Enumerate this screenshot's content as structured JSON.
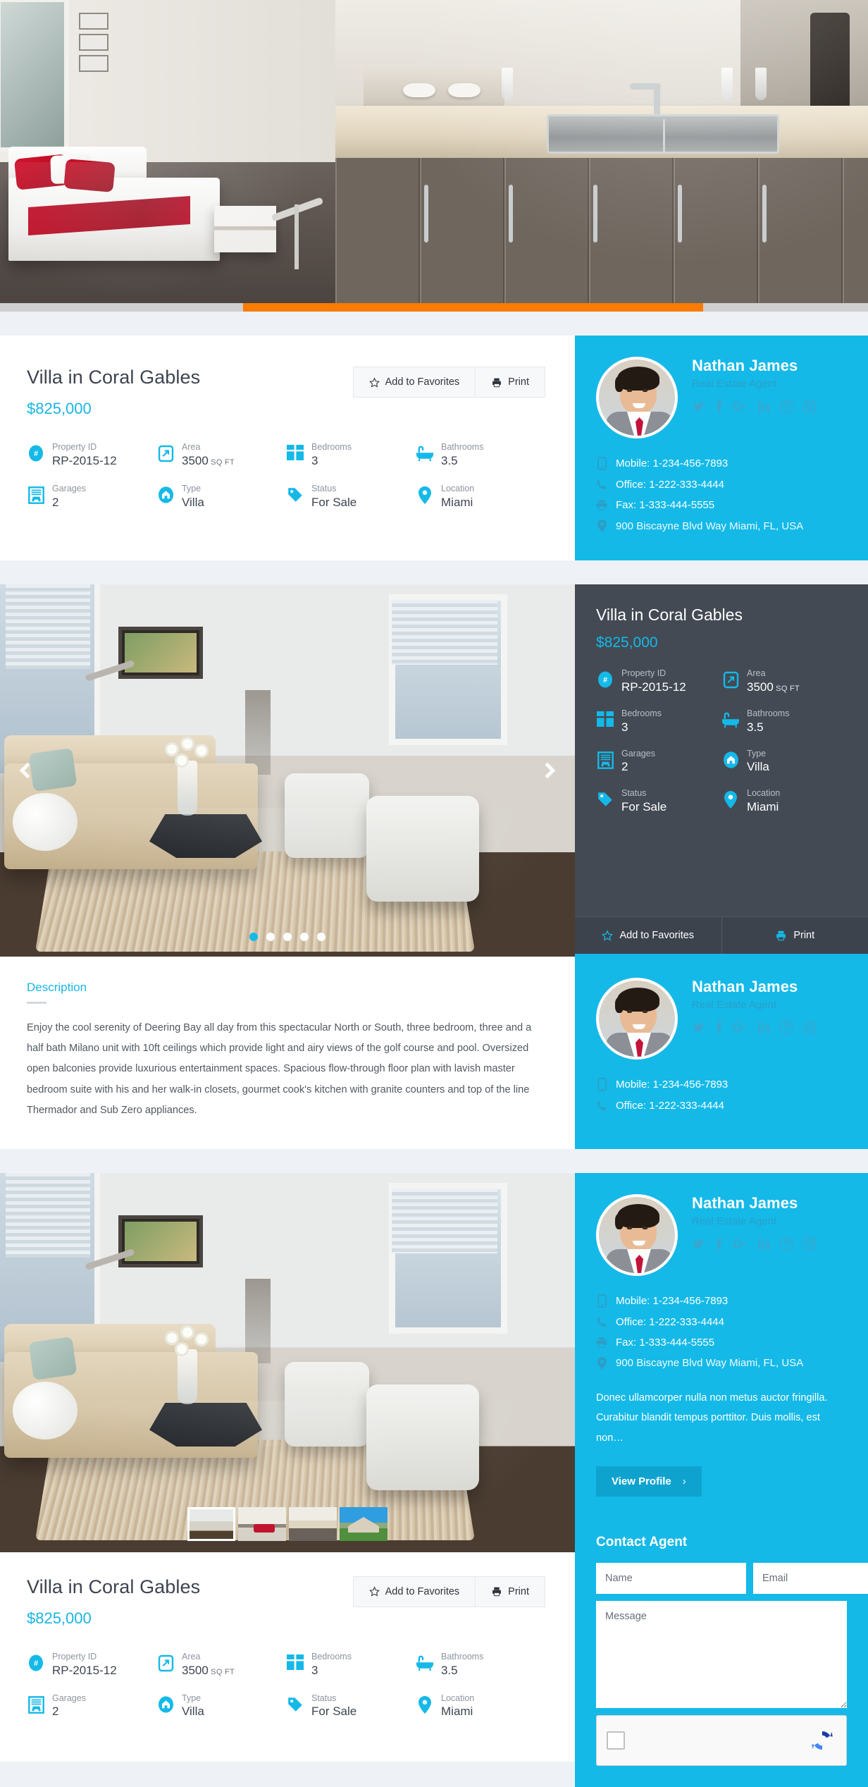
{
  "hero": {
    "progress_percent": 53,
    "progress_color": "#f97c05",
    "left_image_alt": "bedroom-interior",
    "right_image_alt": "kitchen-counter-interior"
  },
  "theme": {
    "accent_blue": "#14b9e8",
    "dark_panel": "#434a54",
    "orange": "#f97c05",
    "page_bg": "#eef1f5"
  },
  "property": {
    "title": "Villa in Coral Gables",
    "price": "$825,000",
    "features": [
      {
        "icon": "hash-icon",
        "label": "Property ID",
        "value": "RP-2015-12",
        "unit": ""
      },
      {
        "icon": "area-icon",
        "label": "Area",
        "value": "3500",
        "unit": "SQ FT"
      },
      {
        "icon": "bedrooms-icon",
        "label": "Bedrooms",
        "value": "3",
        "unit": ""
      },
      {
        "icon": "bathtub-icon",
        "label": "Bathrooms",
        "value": "3.5",
        "unit": ""
      },
      {
        "icon": "garage-icon",
        "label": "Garages",
        "value": "2",
        "unit": ""
      },
      {
        "icon": "home-icon",
        "label": "Type",
        "value": "Villa",
        "unit": ""
      },
      {
        "icon": "tag-icon",
        "label": "Status",
        "value": "For Sale",
        "unit": ""
      },
      {
        "icon": "pin-icon",
        "label": "Location",
        "value": "Miami",
        "unit": ""
      }
    ]
  },
  "actions": {
    "favorites_label": "Add to Favorites",
    "favorites_icon": "star-icon",
    "print_label": "Print",
    "print_icon": "printer-icon"
  },
  "agent": {
    "name": "Nathan James",
    "role": "Real Estate Agent",
    "avatar_alt": "agent-portrait",
    "socials": [
      {
        "name": "twitter-icon",
        "glyph": "twitter"
      },
      {
        "name": "facebook-icon",
        "glyph": "f"
      },
      {
        "name": "googleplus-icon",
        "glyph": "G+"
      },
      {
        "name": "linkedin-icon",
        "glyph": "in"
      },
      {
        "name": "pinterest-icon",
        "glyph": "P"
      },
      {
        "name": "instagram-icon",
        "glyph": "ig"
      }
    ],
    "contacts": [
      {
        "icon": "mobile-icon",
        "text": "Mobile: 1-234-456-7893"
      },
      {
        "icon": "phone-icon",
        "text": "Office: 1-222-333-4444"
      },
      {
        "icon": "fax-icon",
        "text": "Fax: 1-333-444-5555"
      },
      {
        "icon": "pin-icon",
        "text": "900 Biscayne Blvd Way Miami, FL, USA"
      }
    ],
    "contacts_short": [
      {
        "icon": "mobile-icon",
        "text": "Mobile: 1-234-456-7893"
      },
      {
        "icon": "phone-icon",
        "text": "Office: 1-222-333-4444"
      }
    ],
    "bio": "Donec ullamcorper nulla non metus auctor fringilla. Curabitur blandit tempus porttitor. Duis mollis, est non…",
    "view_profile_label": "View Profile",
    "view_profile_chevron": "›"
  },
  "description": {
    "heading": "Description",
    "body": "Enjoy the cool serenity of Deering Bay all day from this spectacular North or South, three bedroom, three and a half bath Milano unit with 10ft ceilings which provide light and airy views of the golf course and pool. Oversized open balconies provide luxurious entertainment spaces. Spacious flow-through floor plan with lavish master bedroom suite with his and her walk-in closets, gourmet cook's kitchen with granite counters and top of the line Thermador and Sub Zero appliances."
  },
  "carousel": {
    "slide_alt": "living-room-interior",
    "dots_total": 5,
    "active_dot": 1,
    "prev_icon": "chevron-left-icon",
    "next_icon": "chevron-right-icon",
    "thumbs_total": 4,
    "active_thumb": 1,
    "thumb_alts": [
      "living-room-thumb",
      "bedroom-thumb",
      "kitchen-thumb",
      "house-exterior-thumb"
    ]
  },
  "contact_form": {
    "title": "Contact Agent",
    "name_placeholder": "Name",
    "email_placeholder": "Email",
    "message_placeholder": "Message",
    "name_value": "",
    "email_value": "",
    "message_value": "",
    "recaptcha_label": ""
  }
}
